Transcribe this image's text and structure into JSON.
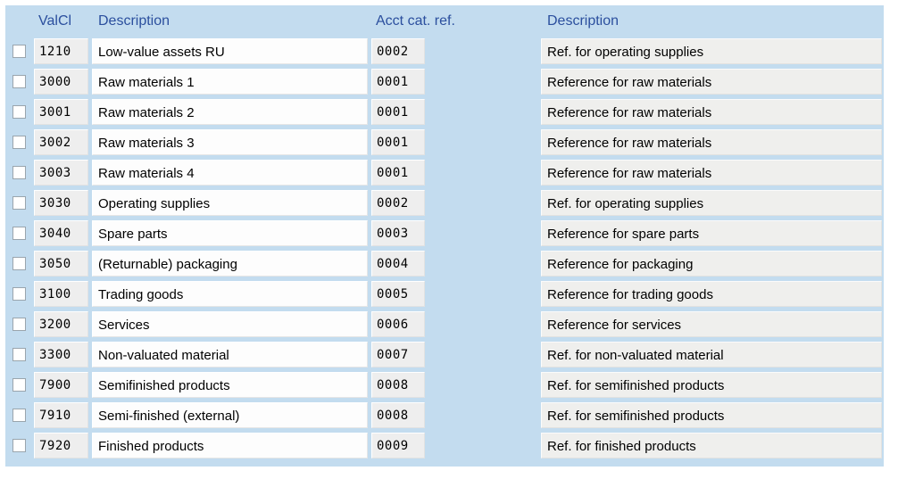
{
  "table": {
    "columns": [
      {
        "id": "select",
        "label": ""
      },
      {
        "id": "valcl",
        "label": "ValCl"
      },
      {
        "id": "desc1",
        "label": "Description"
      },
      {
        "id": "acct",
        "label": "Acct cat. ref."
      },
      {
        "id": "desc2",
        "label": "Description"
      }
    ],
    "rows": [
      {
        "valcl": "1210",
        "desc1": "Low-value assets RU",
        "acct": "0002",
        "desc2": "Ref. for operating supplies"
      },
      {
        "valcl": "3000",
        "desc1": "Raw materials 1",
        "acct": "0001",
        "desc2": "Reference for raw materials"
      },
      {
        "valcl": "3001",
        "desc1": "Raw materials 2",
        "acct": "0001",
        "desc2": "Reference for raw materials"
      },
      {
        "valcl": "3002",
        "desc1": "Raw materials 3",
        "acct": "0001",
        "desc2": "Reference for raw materials"
      },
      {
        "valcl": "3003",
        "desc1": "Raw materials 4",
        "acct": "0001",
        "desc2": "Reference for raw materials"
      },
      {
        "valcl": "3030",
        "desc1": "Operating supplies",
        "acct": "0002",
        "desc2": "Ref. for operating supplies"
      },
      {
        "valcl": "3040",
        "desc1": "Spare parts",
        "acct": "0003",
        "desc2": "Reference for spare parts"
      },
      {
        "valcl": "3050",
        "desc1": "(Returnable) packaging",
        "acct": "0004",
        "desc2": "Reference for packaging"
      },
      {
        "valcl": "3100",
        "desc1": "Trading goods",
        "acct": "0005",
        "desc2": "Reference for trading goods"
      },
      {
        "valcl": "3200",
        "desc1": "Services",
        "acct": "0006",
        "desc2": "Reference for services"
      },
      {
        "valcl": "3300",
        "desc1": "Non-valuated material",
        "acct": "0007",
        "desc2": "Ref. for non-valuated material"
      },
      {
        "valcl": "7900",
        "desc1": "Semifinished products",
        "acct": "0008",
        "desc2": "Ref. for semifinished products"
      },
      {
        "valcl": "7910",
        "desc1": "Semi-finished (external)",
        "acct": "0008",
        "desc2": "Ref. for semifinished products"
      },
      {
        "valcl": "7920",
        "desc1": "Finished products",
        "acct": "0009",
        "desc2": "Ref. for finished products"
      }
    ]
  },
  "colors": {
    "panel_background": "#c3dcef",
    "header_text": "#2b4f9e",
    "key_cell_background": "#eeeeee",
    "text_cell_background": "#fdfdfd",
    "text2_cell_background": "#efefed",
    "checkbox_border": "#9aa5ad"
  }
}
